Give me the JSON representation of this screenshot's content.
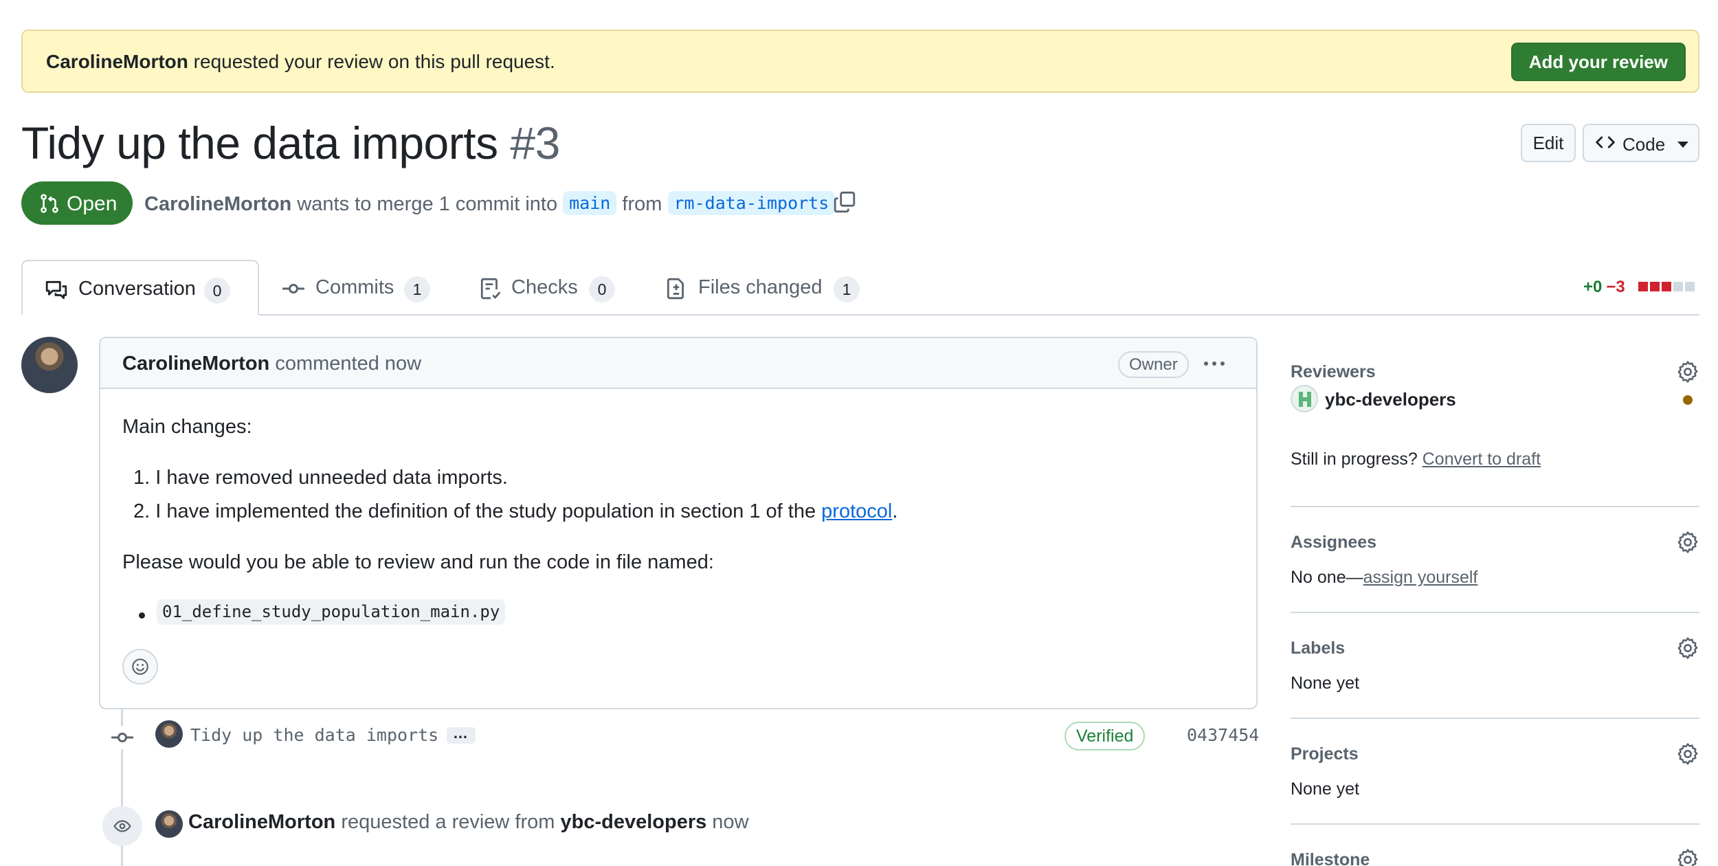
{
  "banner": {
    "author": "CarolineMorton",
    "message": " requested your review on this pull request.",
    "button_label": "Add your review"
  },
  "pr": {
    "title": "Tidy up the data imports",
    "number": "#3",
    "edit_label": "Edit",
    "code_label": "Code",
    "state_label": "Open",
    "author": "CarolineMorton",
    "merge_text": " wants to merge 1 commit into ",
    "base_branch": "main",
    "from_text": " from ",
    "head_branch": "rm-data-imports"
  },
  "tabs": [
    {
      "label": "Conversation",
      "count": "0",
      "icon": "comment-discussion-icon"
    },
    {
      "label": "Commits",
      "count": "1",
      "icon": "commit-icon"
    },
    {
      "label": "Checks",
      "count": "0",
      "icon": "checklist-icon"
    },
    {
      "label": "Files changed",
      "count": "1",
      "icon": "file-diff-icon"
    }
  ],
  "diffstat": {
    "additions": "+0",
    "deletions": "−3"
  },
  "comment": {
    "author": "CarolineMorton",
    "time_text": " commented now",
    "badge": "Owner",
    "intro": "Main changes:",
    "items": [
      {
        "num": "1.",
        "text": "I have removed unneeded data imports."
      },
      {
        "num": "2.",
        "text": "I have implemented the definition of the study population in section 1 of the ",
        "link": "protocol",
        "after": "."
      }
    ],
    "request": "Please would you be able to review and run the code in file named:",
    "filename": "01_define_study_population_main.py"
  },
  "timeline": {
    "commit_message": "Tidy up the data imports",
    "expand_label": "…",
    "verified_label": "Verified",
    "sha": "0437454",
    "review_author": "CarolineMorton",
    "review_text": " requested a review from ",
    "review_team": "ybc-developers",
    "review_time": " now"
  },
  "sidebar": {
    "reviewers": {
      "title": "Reviewers",
      "team": "ybc-developers",
      "progress_text": "Still in progress? ",
      "convert_link": "Convert to draft"
    },
    "assignees": {
      "title": "Assignees",
      "none_text": "No one—",
      "assign_link": "assign yourself"
    },
    "labels": {
      "title": "Labels",
      "value": "None yet"
    },
    "projects": {
      "title": "Projects",
      "value": "None yet"
    },
    "milestone": {
      "title": "Milestone"
    }
  },
  "colors": {
    "accent_green": "#2f7d32",
    "link_blue": "#0969da",
    "banner_bg": "#fff8c5",
    "deletion_red": "#cf222e",
    "addition_green": "#1a7f37"
  }
}
